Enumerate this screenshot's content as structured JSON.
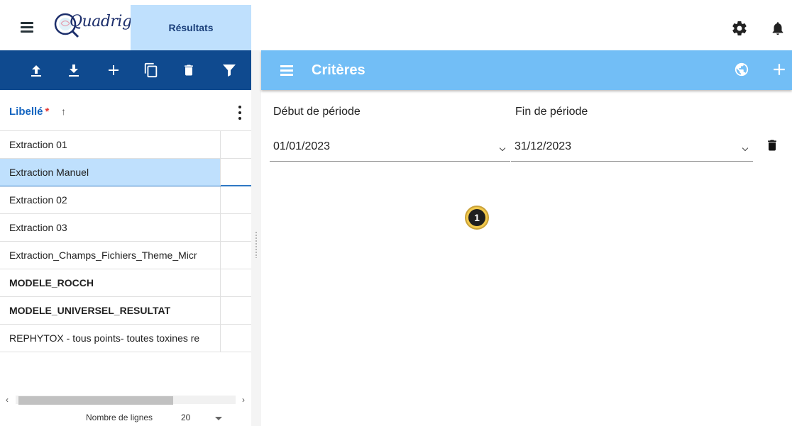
{
  "app": {
    "logo_text": "Quadrige",
    "active_tab": "Résultats"
  },
  "top_icons": [
    "settings-icon",
    "notifications-icon"
  ],
  "left_panel": {
    "toolbar": [
      "upload-icon",
      "download-icon",
      "add-icon",
      "copy-icon",
      "delete-icon",
      "filter-icon"
    ],
    "column_header": "Libellé",
    "required_marker": "*",
    "sort_indicator": "↑",
    "rows": [
      {
        "label": "Extraction 01",
        "bold": false,
        "selected": false
      },
      {
        "label": "Extraction Manuel",
        "bold": false,
        "selected": true
      },
      {
        "label": "Extraction 02",
        "bold": false,
        "selected": false
      },
      {
        "label": "Extraction 03",
        "bold": false,
        "selected": false
      },
      {
        "label": "Extraction_Champs_Fichiers_Theme_Micr",
        "bold": false,
        "selected": false
      },
      {
        "label": "MODELE_ROCCH",
        "bold": true,
        "selected": false
      },
      {
        "label": "MODELE_UNIVERSEL_RESULTAT",
        "bold": true,
        "selected": false
      },
      {
        "label": "REPHYTOX - tous points- toutes toxines re",
        "bold": false,
        "selected": false
      }
    ],
    "footer": {
      "rows_label": "Nombre de lignes",
      "rows_value": "20"
    }
  },
  "right_panel": {
    "title": "Critères",
    "toolbar_icons": [
      "globe-icon",
      "add-icon"
    ],
    "start_label": "Début de période",
    "end_label": "Fin de période",
    "start_value": "01/01/2023",
    "end_value": "31/12/2023"
  },
  "annotation": {
    "number": "1"
  },
  "colors": {
    "left_toolbar": "#0f4a8f",
    "right_toolbar": "#72bef6",
    "active_tab": "#bfe0fd",
    "selected_row": "#bfe0fd",
    "badge": "#f2c94c"
  }
}
